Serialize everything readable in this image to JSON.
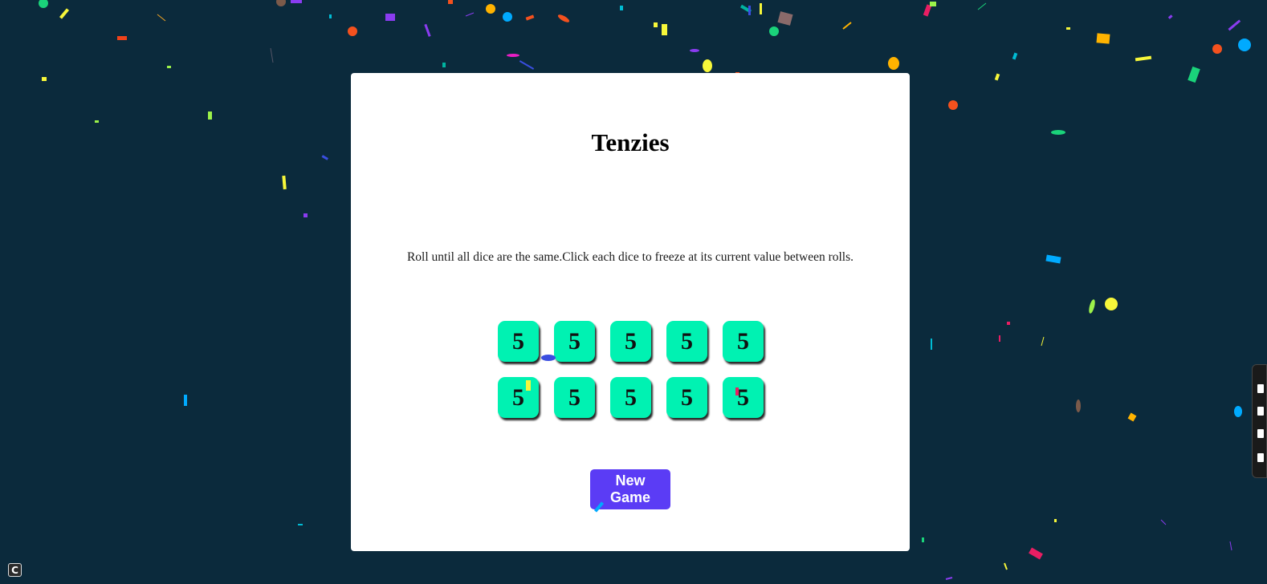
{
  "app": {
    "title": "Tenzies",
    "instructions": "Roll until all dice are the same.Click each dice to freeze at its current value between rolls."
  },
  "dice": [
    "5",
    "5",
    "5",
    "5",
    "5",
    "5",
    "5",
    "5",
    "5",
    "5"
  ],
  "controls": {
    "new_game_label": "New Game"
  },
  "corner_button": {
    "icon_glyph": "C"
  },
  "colors": {
    "background": "#0b2a3c",
    "card": "#ffffff",
    "die": "#00f2b2",
    "button": "#5b3cf5"
  }
}
